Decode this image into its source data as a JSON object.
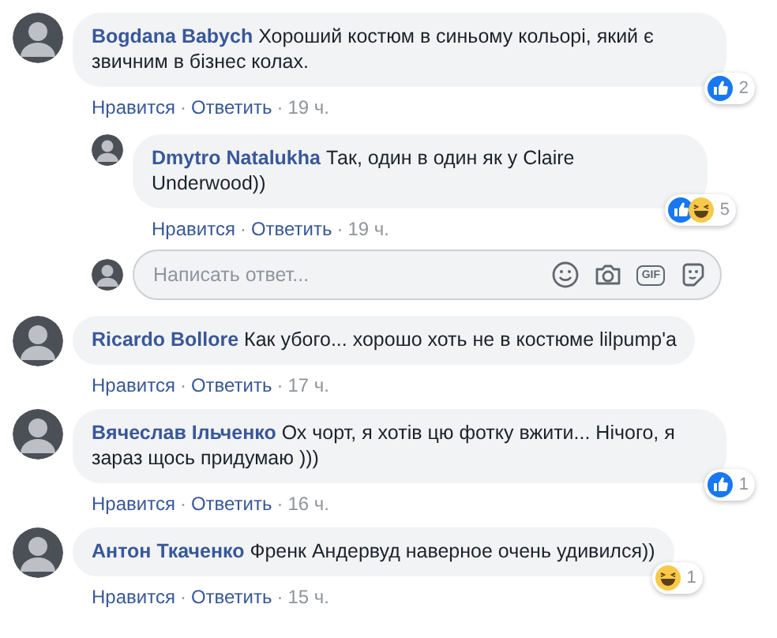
{
  "separator": "·",
  "comments": [
    {
      "author": "Bogdana Babych",
      "text": "Хороший костюм в синьому кольорі, який є звичним в бізнес колах.",
      "actions": [
        "Нравится",
        "Ответить"
      ],
      "time": "19 ч.",
      "reactions": [
        {
          "kind": "like"
        }
      ],
      "reaction_count": "2",
      "replies": [
        {
          "author": "Dmytro Natalukha",
          "text": "Так, один в один як у Claire Underwood))",
          "actions": [
            "Нравится",
            "Ответить"
          ],
          "time": "19 ч.",
          "reactions": [
            {
              "kind": "like"
            },
            {
              "kind": "haha"
            }
          ],
          "reaction_count": "5"
        }
      ],
      "reply_box": {
        "placeholder": "Написать ответ...",
        "gif_label": "GIF"
      }
    },
    {
      "author": "Ricardo Bollore",
      "text": "Как убого... хорошо хоть не в костюме lilpump'a",
      "actions": [
        "Нравится",
        "Ответить"
      ],
      "time": "17 ч."
    },
    {
      "author": "Вячеслав Ільченко",
      "text": "Ох чорт, я хотів цю фотку вжити... Нічого, я зараз щось придумаю )))",
      "actions": [
        "Нравится",
        "Ответить"
      ],
      "time": "16 ч.",
      "reactions": [
        {
          "kind": "like"
        }
      ],
      "reaction_count": "1"
    },
    {
      "author": "Антон Ткаченко",
      "text": "Френк Андервуд наверное очень удивился))",
      "actions": [
        "Нравится",
        "Ответить"
      ],
      "time": "15 ч.",
      "reactions": [
        {
          "kind": "haha"
        }
      ],
      "reaction_count": "1"
    }
  ]
}
